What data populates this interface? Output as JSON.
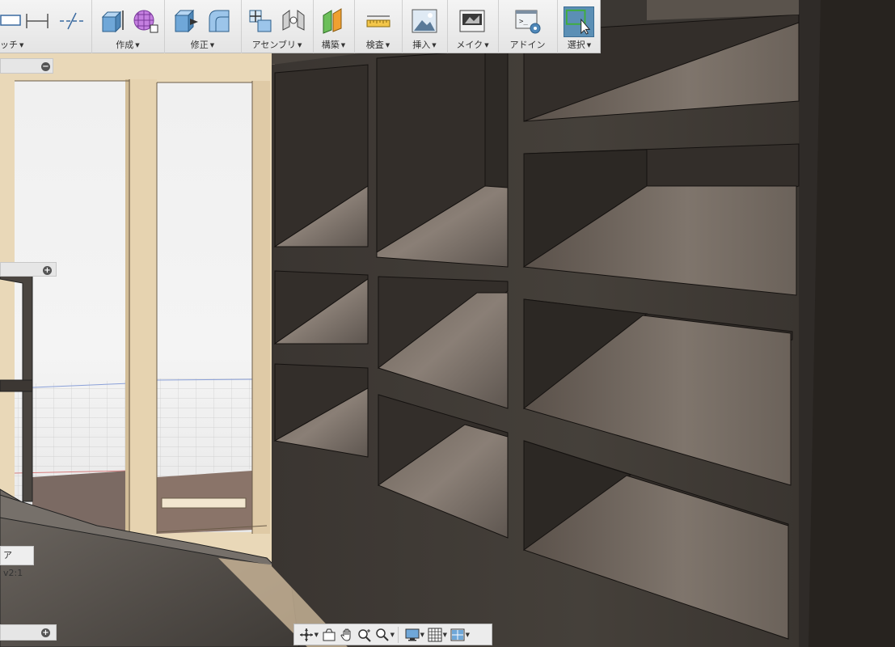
{
  "ribbon": {
    "sketch_label": "ッチ",
    "create_label": "作成",
    "modify_label": "修正",
    "assemble_label": "アセンブリ",
    "construct_label": "構築",
    "inspect_label": "検査",
    "insert_label": "挿入",
    "make_label": "メイク",
    "addins_label": "アドイン",
    "select_label": "選択"
  },
  "browser": {
    "version_label": "ア v2:1"
  },
  "colors": {
    "shelf_dark": "#3a3530",
    "door_frame": "#e8d6b6",
    "select_active": "#5b8fb5"
  },
  "navbar": {
    "icons": [
      "orbit-icon",
      "look-at-icon",
      "pan-icon",
      "zoom-icon",
      "fit-icon",
      "display-settings-icon",
      "grid-settings-icon",
      "viewports-icon"
    ]
  }
}
